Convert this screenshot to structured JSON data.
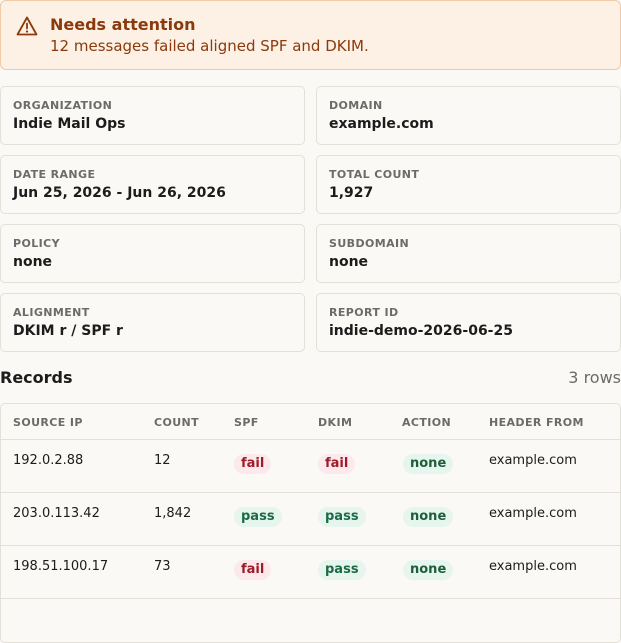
{
  "alert": {
    "title": "Needs attention",
    "message": "12 messages failed aligned SPF and DKIM.",
    "icon": "warning-triangle-icon"
  },
  "summary": [
    {
      "label": "ORGANIZATION",
      "value": "Indie Mail Ops"
    },
    {
      "label": "DOMAIN",
      "value": "example.com"
    },
    {
      "label": "DATE RANGE",
      "value": "Jun 25, 2026 - Jun 26, 2026"
    },
    {
      "label": "TOTAL COUNT",
      "value": "1,927"
    },
    {
      "label": "POLICY",
      "value": "none"
    },
    {
      "label": "SUBDOMAIN",
      "value": "none"
    },
    {
      "label": "ALIGNMENT",
      "value": "DKIM r / SPF r"
    },
    {
      "label": "REPORT ID",
      "value": "indie-demo-2026-06-25"
    }
  ],
  "records": {
    "title": "Records",
    "count_label": "3 rows",
    "columns": [
      "SOURCE IP",
      "COUNT",
      "SPF",
      "DKIM",
      "ACTION",
      "HEADER FROM"
    ],
    "rows": [
      {
        "source_ip": "192.0.2.88",
        "count": "12",
        "spf": "fail",
        "dkim": "fail",
        "action": "none",
        "header_from": "example.com"
      },
      {
        "source_ip": "203.0.113.42",
        "count": "1,842",
        "spf": "pass",
        "dkim": "pass",
        "action": "none",
        "header_from": "example.com"
      },
      {
        "source_ip": "198.51.100.17",
        "count": "73",
        "spf": "fail",
        "dkim": "pass",
        "action": "none",
        "header_from": "example.com"
      }
    ]
  },
  "colors": {
    "alert_bg": "#fdf0e4",
    "alert_text": "#8a3a0c",
    "fail": "#9d1c2a",
    "pass": "#1d6b45"
  }
}
